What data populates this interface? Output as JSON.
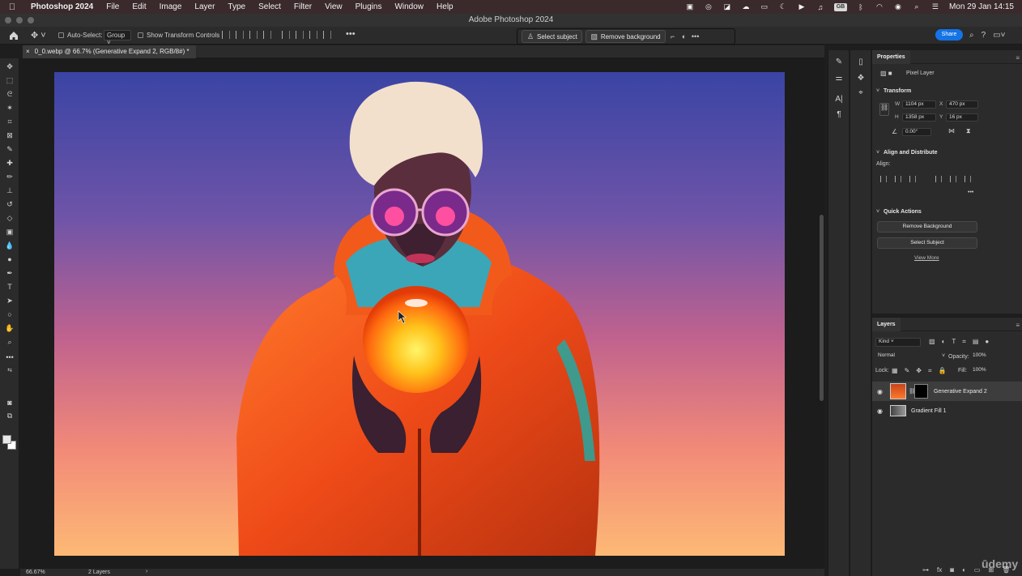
{
  "menubar": {
    "app": "Photoshop 2024",
    "items": [
      "File",
      "Edit",
      "Image",
      "Layer",
      "Type",
      "Select",
      "Filter",
      "View",
      "Plugins",
      "Window",
      "Help"
    ],
    "datetime": "Mon 29 Jan  14:15",
    "keyboard": "GB"
  },
  "window": {
    "title": "Adobe Photoshop 2024"
  },
  "options": {
    "auto_select_label": "Auto-Select:",
    "group_value": "Group",
    "show_transform_label": "Show Transform Controls",
    "more": "•••"
  },
  "contextual": {
    "select_subject": "Select subject",
    "remove_background": "Remove background",
    "more": "•••"
  },
  "share_label": "Share",
  "document": {
    "tab_title": "0_0.webp @ 66.7% (Generative Expand 2, RGB/8#) *",
    "close": "×"
  },
  "status": {
    "zoom": "66.67%",
    "layers_count": "2 Layers",
    "arrow": "›"
  },
  "properties": {
    "tab_label": "Properties",
    "layer_kind": "Pixel Layer",
    "transform_title": "Transform",
    "w_label": "W",
    "w_value": "1104 px",
    "h_label": "H",
    "h_value": "1358 px",
    "x_label": "X",
    "x_value": "470 px",
    "y_label": "Y",
    "y_value": "16 px",
    "angle_value": "0.00°",
    "align_title": "Align and Distribute",
    "align_label": "Align:",
    "quick_title": "Quick Actions",
    "remove_bg_btn": "Remove Background",
    "select_subject_btn": "Select Subject",
    "view_more": "View More",
    "more": "•••"
  },
  "layers": {
    "tab_label": "Layers",
    "kind_filter": "Kind",
    "blend_mode": "Normal",
    "opacity_label": "Opacity:",
    "opacity_value": "100%",
    "lock_label": "Lock:",
    "fill_label": "Fill:",
    "fill_value": "100%",
    "items": [
      {
        "name": "Generative Expand 2",
        "selected": true
      },
      {
        "name": "Gradient Fill 1",
        "selected": false
      }
    ]
  },
  "watermark": "ūdemy",
  "colors": {
    "accent": "#1473e6",
    "panel": "#2b2b2b",
    "canvas_gradient_top": "#3a44a4",
    "canvas_gradient_bottom": "#fdb975"
  }
}
